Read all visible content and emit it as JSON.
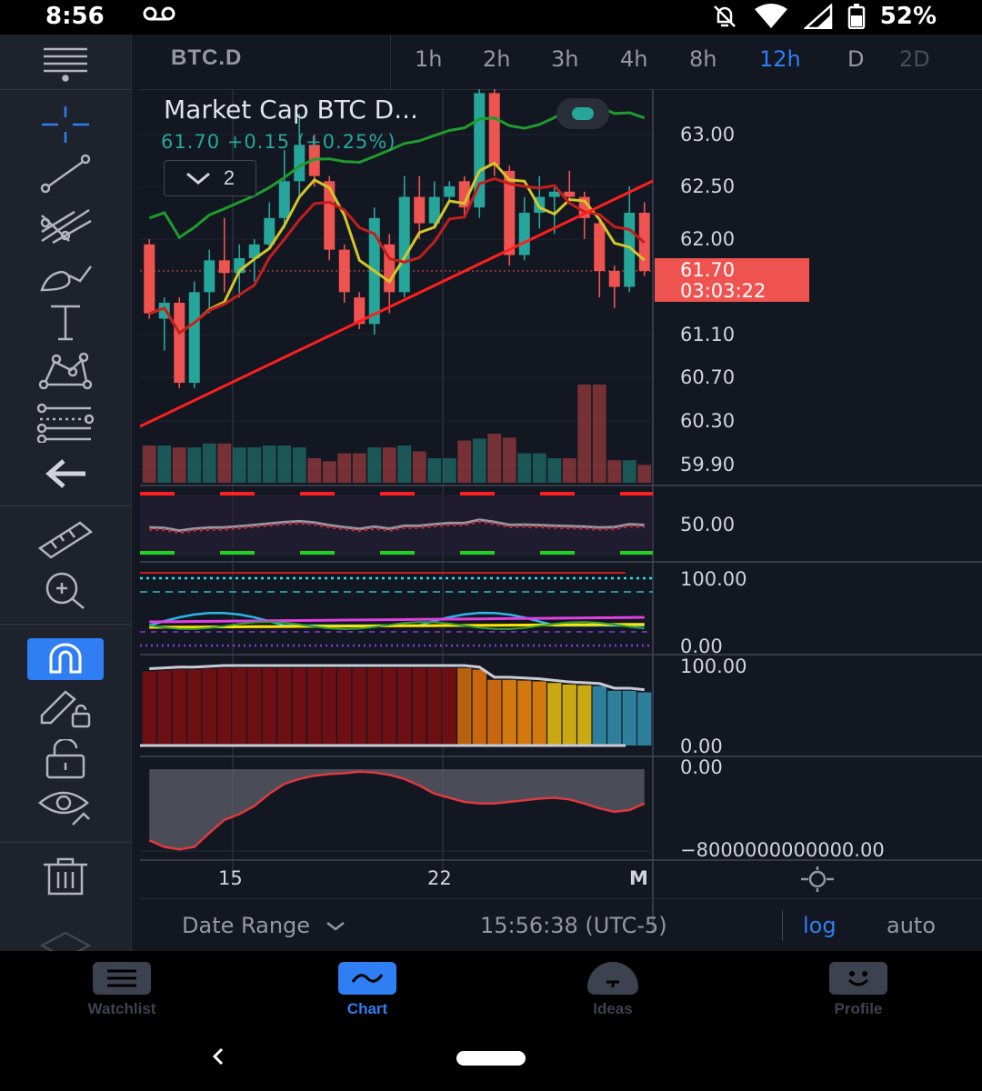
{
  "status": {
    "time": "8:56",
    "battery": "52%"
  },
  "symbol": "BTC.D",
  "timeframes": [
    {
      "label": "1h",
      "state": "normal"
    },
    {
      "label": "2h",
      "state": "normal"
    },
    {
      "label": "3h",
      "state": "normal"
    },
    {
      "label": "4h",
      "state": "normal"
    },
    {
      "label": "8h",
      "state": "normal"
    },
    {
      "label": "12h",
      "state": "active"
    },
    {
      "label": "D",
      "state": "normal"
    },
    {
      "label": "2D",
      "state": "dim"
    }
  ],
  "legend": {
    "title": "Market Cap BTC D...",
    "values": "61.70  +0.15 (+0.25%)",
    "indicators_count": "2"
  },
  "price_axis": [
    "63.00",
    "62.50",
    "62.00",
    "61.10",
    "60.70",
    "60.30",
    "59.90"
  ],
  "last_price": {
    "price": "61.70",
    "countdown": "03:03:22"
  },
  "pane_axes": {
    "rsi": "50.00",
    "osc_top": "100.00",
    "osc_bottom": "0.00",
    "hist_top": "100.00",
    "hist_bottom": "0.00",
    "flow_top": "0.00",
    "flow_bottom": "−8000000000000.00"
  },
  "date_axis": [
    "15",
    "22",
    "M"
  ],
  "bottom_bar": {
    "date_range": "Date Range",
    "clock": "15:56:38 (UTC-5)",
    "log": "log",
    "auto": "auto"
  },
  "nav": {
    "watchlist": "Watchlist",
    "chart": "Chart",
    "ideas": "Ideas",
    "profile": "Profile"
  },
  "colors": {
    "up": "#26a69a",
    "down": "#ef5350",
    "accent": "#2f7ef3",
    "background": "#131722"
  },
  "chart_data": {
    "type": "candlestick",
    "symbol": "BTC.D",
    "interval": "12h",
    "y_axis_ticks": [
      63.0,
      62.5,
      62.0,
      61.1,
      60.7,
      60.3,
      59.9
    ],
    "x_axis_ticks": [
      "15",
      "22",
      "M"
    ],
    "last_value": 61.7,
    "change": 0.15,
    "change_pct": 0.25,
    "candles": [
      {
        "o": 61.95,
        "h": 62.0,
        "l": 61.25,
        "c": 61.3
      },
      {
        "o": 61.25,
        "h": 61.45,
        "l": 60.95,
        "c": 61.4
      },
      {
        "o": 61.4,
        "h": 61.45,
        "l": 60.6,
        "c": 60.65
      },
      {
        "o": 60.65,
        "h": 61.6,
        "l": 60.6,
        "c": 61.5
      },
      {
        "o": 61.5,
        "h": 61.9,
        "l": 61.3,
        "c": 61.8
      },
      {
        "o": 61.8,
        "h": 62.2,
        "l": 61.5,
        "c": 61.68
      },
      {
        "o": 61.68,
        "h": 61.95,
        "l": 61.45,
        "c": 61.82
      },
      {
        "o": 61.82,
        "h": 62.0,
        "l": 61.6,
        "c": 61.95
      },
      {
        "o": 61.95,
        "h": 62.35,
        "l": 61.9,
        "c": 62.2
      },
      {
        "o": 62.2,
        "h": 62.85,
        "l": 62.1,
        "c": 62.55
      },
      {
        "o": 62.55,
        "h": 63.2,
        "l": 62.4,
        "c": 62.9
      },
      {
        "o": 62.9,
        "h": 63.0,
        "l": 62.5,
        "c": 62.6
      },
      {
        "o": 62.55,
        "h": 62.6,
        "l": 61.8,
        "c": 61.9
      },
      {
        "o": 61.9,
        "h": 61.95,
        "l": 61.4,
        "c": 61.5
      },
      {
        "o": 61.45,
        "h": 61.5,
        "l": 61.15,
        "c": 61.2
      },
      {
        "o": 61.2,
        "h": 62.3,
        "l": 61.1,
        "c": 62.2
      },
      {
        "o": 61.95,
        "h": 62.05,
        "l": 61.3,
        "c": 61.5
      },
      {
        "o": 61.5,
        "h": 62.6,
        "l": 61.45,
        "c": 62.4
      },
      {
        "o": 62.4,
        "h": 62.6,
        "l": 62.0,
        "c": 62.15
      },
      {
        "o": 62.15,
        "h": 62.55,
        "l": 62.1,
        "c": 62.4
      },
      {
        "o": 62.4,
        "h": 62.55,
        "l": 62.35,
        "c": 62.5
      },
      {
        "o": 62.55,
        "h": 62.6,
        "l": 62.2,
        "c": 62.3
      },
      {
        "o": 62.3,
        "h": 63.6,
        "l": 62.2,
        "c": 63.4
      },
      {
        "o": 63.4,
        "h": 63.5,
        "l": 62.6,
        "c": 62.7
      },
      {
        "o": 62.65,
        "h": 62.7,
        "l": 61.75,
        "c": 61.85
      },
      {
        "o": 61.85,
        "h": 62.4,
        "l": 61.8,
        "c": 62.25
      },
      {
        "o": 62.25,
        "h": 62.6,
        "l": 62.1,
        "c": 62.4
      },
      {
        "o": 62.4,
        "h": 62.5,
        "l": 62.05,
        "c": 62.45
      },
      {
        "o": 62.45,
        "h": 62.65,
        "l": 62.35,
        "c": 62.4
      },
      {
        "o": 62.4,
        "h": 62.45,
        "l": 62.0,
        "c": 62.2
      },
      {
        "o": 62.15,
        "h": 62.2,
        "l": 61.45,
        "c": 61.7
      },
      {
        "o": 61.7,
        "h": 61.75,
        "l": 61.35,
        "c": 61.55
      },
      {
        "o": 61.55,
        "h": 62.5,
        "l": 61.5,
        "c": 62.25
      },
      {
        "o": 62.25,
        "h": 62.35,
        "l": 61.65,
        "c": 61.7
      }
    ],
    "volume": [
      0.38,
      0.38,
      0.36,
      0.36,
      0.4,
      0.4,
      0.36,
      0.36,
      0.38,
      0.38,
      0.36,
      0.25,
      0.22,
      0.3,
      0.3,
      0.36,
      0.36,
      0.38,
      0.32,
      0.25,
      0.25,
      0.43,
      0.45,
      0.5,
      0.46,
      0.3,
      0.3,
      0.25,
      0.25,
      1.0,
      1.0,
      0.23,
      0.23,
      0.18
    ],
    "rsi_levels": {
      "upper_dashed": "red",
      "lower_dashed": "green",
      "mid_axis": 50
    },
    "histogram": [
      95,
      96,
      97,
      97,
      98,
      99,
      99,
      99,
      99,
      99,
      99,
      99,
      99,
      99,
      99,
      99,
      99,
      99,
      99,
      99,
      99,
      99,
      97,
      84,
      84,
      83,
      82,
      80,
      78,
      77,
      76,
      70,
      70,
      68
    ],
    "histogram_range": [
      0,
      100
    ],
    "flow_range": [
      -8000000000000,
      0
    ]
  }
}
